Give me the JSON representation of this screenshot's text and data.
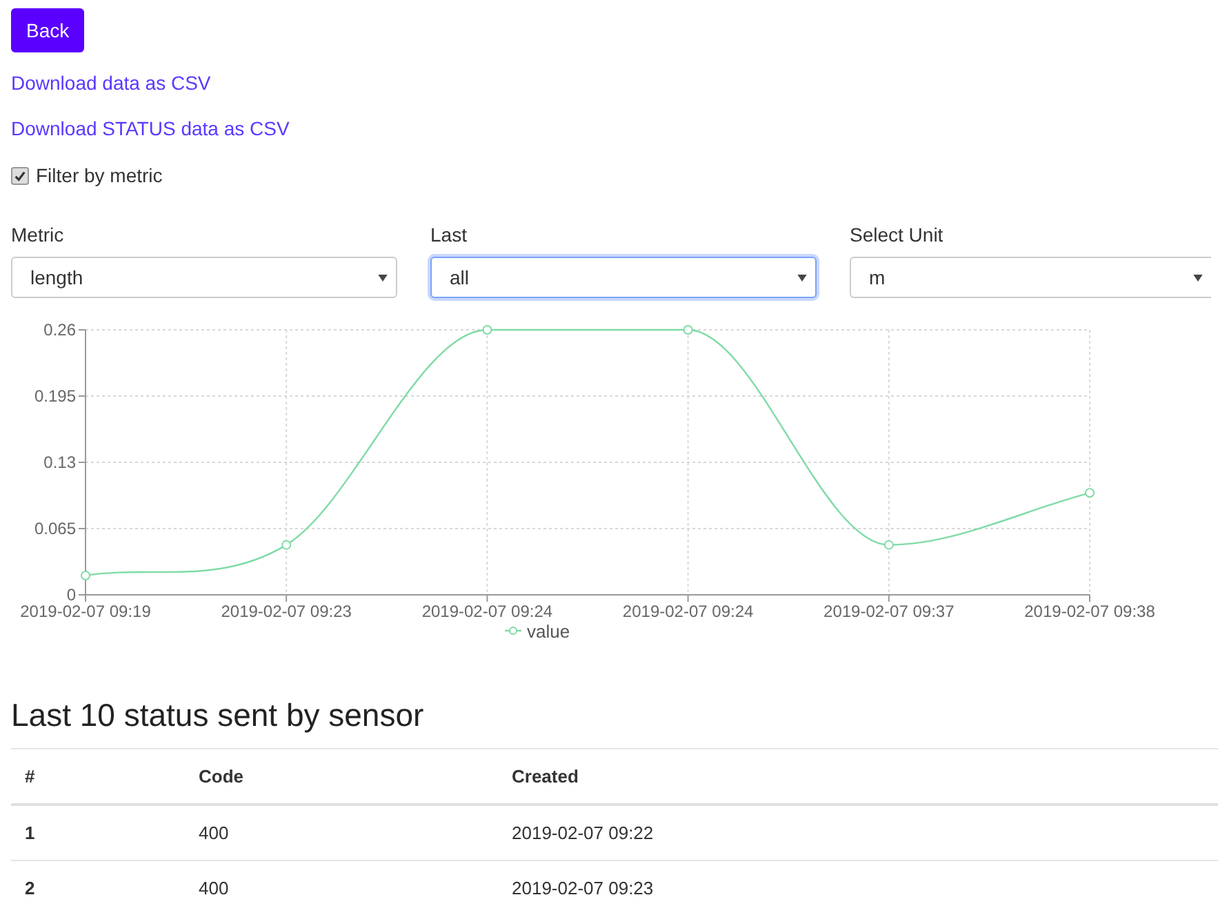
{
  "back_button": "Back",
  "links": [
    "Download data as CSV",
    "Download STATUS data as CSV"
  ],
  "filter": {
    "label": "Filter by metric",
    "checked": true
  },
  "selects": [
    {
      "label": "Metric",
      "value": "length",
      "focused": false
    },
    {
      "label": "Last",
      "value": "all",
      "focused": true
    },
    {
      "label": "Select Unit",
      "value": "m",
      "focused": false
    }
  ],
  "chart": {
    "chart_data": {
      "type": "line",
      "categories": [
        "2019-02-07 09:19",
        "2019-02-07 09:23",
        "2019-02-07 09:24",
        "2019-02-07 09:24",
        "2019-02-07 09:37",
        "2019-02-07 09:38"
      ],
      "series": [
        {
          "name": "value",
          "color": "#7fdba5",
          "marker": "circle",
          "values": [
            0.019,
            0.049,
            0.26,
            0.26,
            0.049,
            0.1
          ]
        }
      ],
      "grid": true,
      "ylim": [
        0,
        0.26
      ],
      "yticks": [
        0,
        0.065,
        0.13,
        0.195,
        0.26
      ]
    }
  },
  "status": {
    "title": "Last 10 status sent by sensor",
    "columns": [
      "#",
      "Code",
      "Created"
    ],
    "rows": [
      [
        "1",
        "400",
        "2019-02-07 09:22"
      ],
      [
        "2",
        "400",
        "2019-02-07 09:23"
      ]
    ]
  }
}
